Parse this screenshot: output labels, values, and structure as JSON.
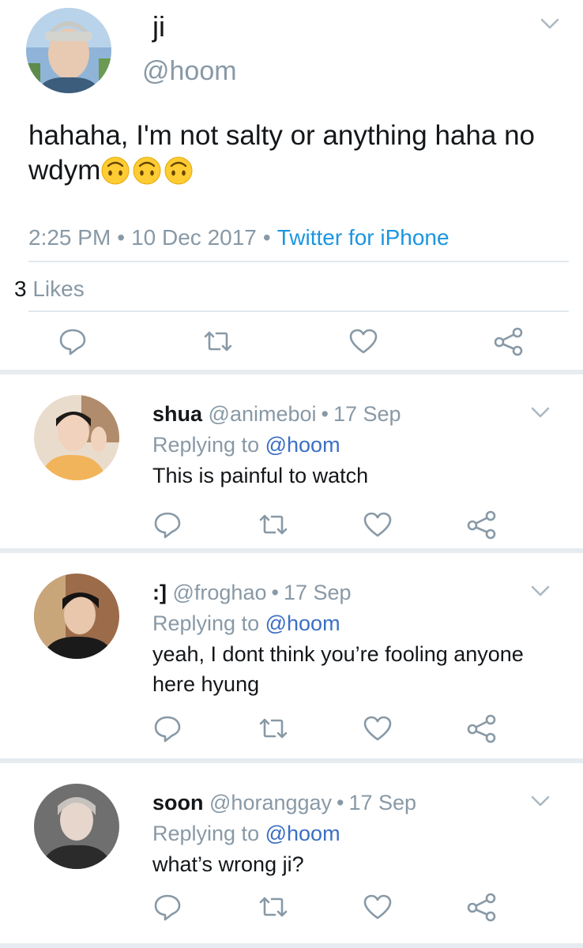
{
  "main_tweet": {
    "display_name": "ji",
    "handle": "@hoom",
    "text": "hahaha, I'm not salty or anything haha no wdym",
    "emoji": [
      "upside-down-face-emoji",
      "upside-down-face-emoji",
      "upside-down-face-emoji"
    ],
    "time": "2:25 PM",
    "date": "10 Dec 2017",
    "source": "Twitter for iPhone",
    "likes_count": "3",
    "likes_label": "Likes"
  },
  "replies": [
    {
      "display_name": "shua",
      "handle": "@animeboi",
      "date": "17 Sep",
      "replying_label": "Replying to",
      "replying_to": "@hoom",
      "text": "This is painful to watch"
    },
    {
      "display_name": ":]",
      "handle": "@froghao",
      "date": "17 Sep",
      "replying_label": "Replying to",
      "replying_to": "@hoom",
      "text": "yeah, I dont think you’re fooling anyone here hyung"
    },
    {
      "display_name": "soon",
      "handle": "@horanggay",
      "date": "17 Sep",
      "replying_label": "Replying to",
      "replying_to": "@hoom",
      "text": "what’s wrong ji?"
    }
  ],
  "icons": {
    "reply": "reply-icon",
    "retweet": "retweet-icon",
    "like": "heart-icon",
    "share": "share-icon",
    "more": "chevron-down-icon"
  },
  "colors": {
    "link_blue": "#1b95e0",
    "mention_blue": "#3b6fc4",
    "muted_grey": "#8899a6",
    "text_dark": "#14171a",
    "divider": "#e1e8ed"
  }
}
